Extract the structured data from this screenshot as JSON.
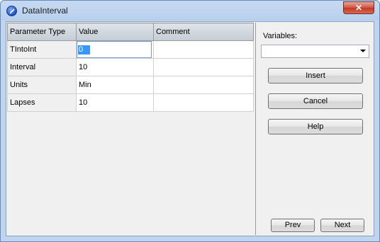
{
  "window": {
    "title": "DataInterval",
    "close_label": "✕"
  },
  "grid": {
    "columns": [
      "Parameter Type",
      "Value",
      "Comment"
    ],
    "rows": [
      {
        "param": "TIntoInt",
        "value": "0",
        "comment": ""
      },
      {
        "param": "Interval",
        "value": "10",
        "comment": ""
      },
      {
        "param": "Units",
        "value": "Min",
        "comment": ""
      },
      {
        "param": "Lapses",
        "value": "10",
        "comment": ""
      }
    ]
  },
  "sidebar": {
    "variables_label": "Variables:",
    "variables_value": "",
    "insert_label": "Insert",
    "cancel_label": "Cancel",
    "help_label": "Help",
    "prev_label": "Prev",
    "next_label": "Next"
  }
}
